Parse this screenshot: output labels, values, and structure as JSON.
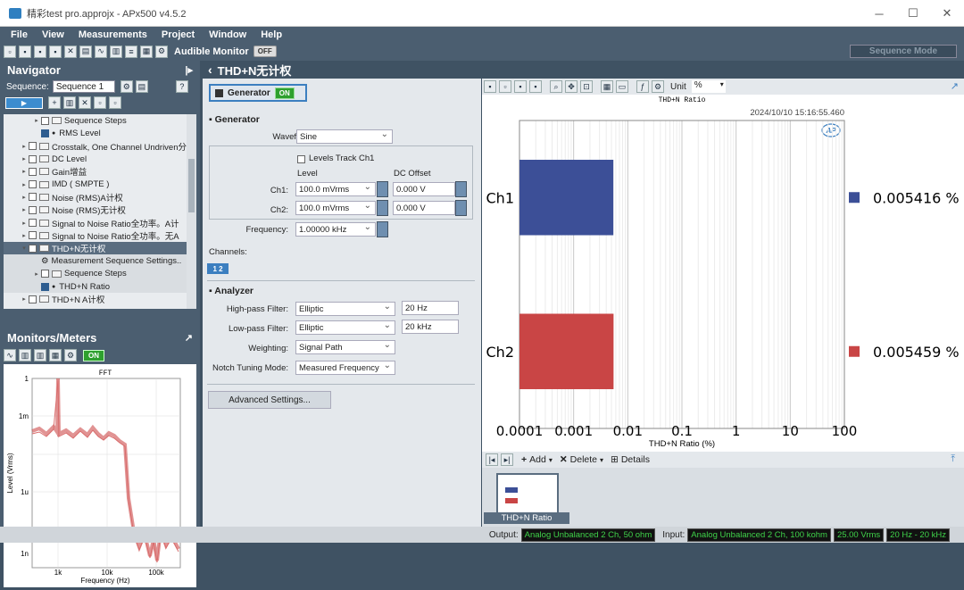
{
  "window": {
    "title": "精彩test pro.approjx - APx500 v4.5.2",
    "minimize": "─",
    "maximize": "☐",
    "close": "✕"
  },
  "menu": [
    "File",
    "View",
    "Measurements",
    "Project",
    "Window",
    "Help"
  ],
  "toolbar": {
    "audible_monitor": "Audible Monitor",
    "audible_state": "OFF",
    "sequence_mode": "Sequence Mode"
  },
  "navigator": {
    "title": "Navigator",
    "sequence_label": "Sequence:",
    "sequence_value": "Sequence 1",
    "items": [
      {
        "label": "Sequence Steps",
        "level": 2,
        "arrow": "▸",
        "type": "folder"
      },
      {
        "label": "RMS Level",
        "level": 2,
        "checked": true,
        "type": "result"
      },
      {
        "label": "Crosstalk, One Channel Undriven分",
        "level": 1,
        "arrow": "▸",
        "type": "folder"
      },
      {
        "label": "DC Level",
        "level": 1,
        "arrow": "▸",
        "type": "folder"
      },
      {
        "label": "Gain增益",
        "level": 1,
        "arrow": "▸",
        "type": "folder"
      },
      {
        "label": "IMD ( SMPTE )",
        "level": 1,
        "arrow": "▸",
        "type": "folder"
      },
      {
        "label": "Noise (RMS)A计权",
        "level": 1,
        "arrow": "▸",
        "type": "folder"
      },
      {
        "label": "Noise (RMS)无计权",
        "level": 1,
        "arrow": "▸",
        "type": "folder"
      },
      {
        "label": "Signal to Noise Ratio全功率。A计",
        "level": 1,
        "arrow": "▸",
        "type": "folder"
      },
      {
        "label": "Signal to Noise Ratio全功率。无A",
        "level": 1,
        "arrow": "▸",
        "type": "folder"
      },
      {
        "label": "THD+N无计权",
        "level": 1,
        "arrow": "▾",
        "type": "folder",
        "selected": true
      },
      {
        "label": "Measurement Sequence Settings..",
        "level": 2,
        "type": "settings",
        "sub": true
      },
      {
        "label": "Sequence Steps",
        "level": 2,
        "arrow": "▸",
        "type": "folder",
        "sub": true
      },
      {
        "label": "THD+N Ratio",
        "level": 2,
        "checked": true,
        "type": "result",
        "sub": true
      },
      {
        "label": "THD+N A计权",
        "level": 1,
        "arrow": "▸",
        "type": "folder"
      }
    ]
  },
  "monitors": {
    "title": "Monitors/Meters",
    "on": "ON"
  },
  "fft": {
    "title": "FFT",
    "ylabel": "Level (Vrms)",
    "xlabel": "Frequency (Hz)",
    "yticks": [
      "1",
      "1m",
      "1u",
      "1n"
    ],
    "xticks": [
      "1k",
      "10k",
      "100k"
    ]
  },
  "measurement": {
    "back": "‹",
    "title": "THD+N无计权"
  },
  "generator": {
    "button": "Generator",
    "state": "ON",
    "section": "Generator",
    "waveform_label": "Waveform:",
    "waveform": "Sine",
    "levels_track": "Levels Track Ch1",
    "level_hdr": "Level",
    "dc_hdr": "DC Offset",
    "ch1_label": "Ch1:",
    "ch1_level": "100.0 mVrms",
    "ch1_dc": "0.000 V",
    "ch2_label": "Ch2:",
    "ch2_level": "100.0 mVrms",
    "ch2_dc": "0.000 V",
    "freq_label": "Frequency:",
    "freq": "1.00000 kHz",
    "channels_label": "Channels:",
    "channels": "1 2"
  },
  "analyzer": {
    "section": "Analyzer",
    "hp_label": "High-pass Filter:",
    "hp": "Elliptic",
    "hp_freq": "20 Hz",
    "lp_label": "Low-pass Filter:",
    "lp": "Elliptic",
    "lp_freq": "20 kHz",
    "weighting_label": "Weighting:",
    "weighting": "Signal Path",
    "notch_label": "Notch Tuning Mode:",
    "notch": "Measured Frequency",
    "advanced": "Advanced Settings..."
  },
  "graph_toolbar": {
    "unit_label": "Unit",
    "unit": "%"
  },
  "chart_data": {
    "type": "bar",
    "orientation": "horizontal",
    "title": "THD+N Ratio",
    "timestamp": "2024/10/10 15:16:55.460",
    "categories": [
      "Ch1",
      "Ch2"
    ],
    "values": [
      0.005416,
      0.005459
    ],
    "value_labels": [
      "0.005416 %",
      "0.005459 %"
    ],
    "colors": [
      "#3c4f97",
      "#c94545"
    ],
    "xlabel": "THD+N Ratio (%)",
    "xscale": "log",
    "xlim": [
      0.0001,
      100
    ],
    "xticks": [
      "0.0001",
      "0.001",
      "0.01",
      "0.1",
      "1",
      "10",
      "100"
    ],
    "logo": "AP"
  },
  "results_bar": {
    "add": "Add",
    "delete": "Delete",
    "details": "Details"
  },
  "thumbnail": {
    "label": "THD+N Ratio"
  },
  "status": {
    "output_label": "Output:",
    "output": "Analog Unbalanced 2 Ch, 50 ohm",
    "input_label": "Input:",
    "input": "Analog Unbalanced 2 Ch, 100 kohm",
    "range": "25.00 Vrms",
    "bandwidth": "20 Hz - 20 kHz"
  }
}
